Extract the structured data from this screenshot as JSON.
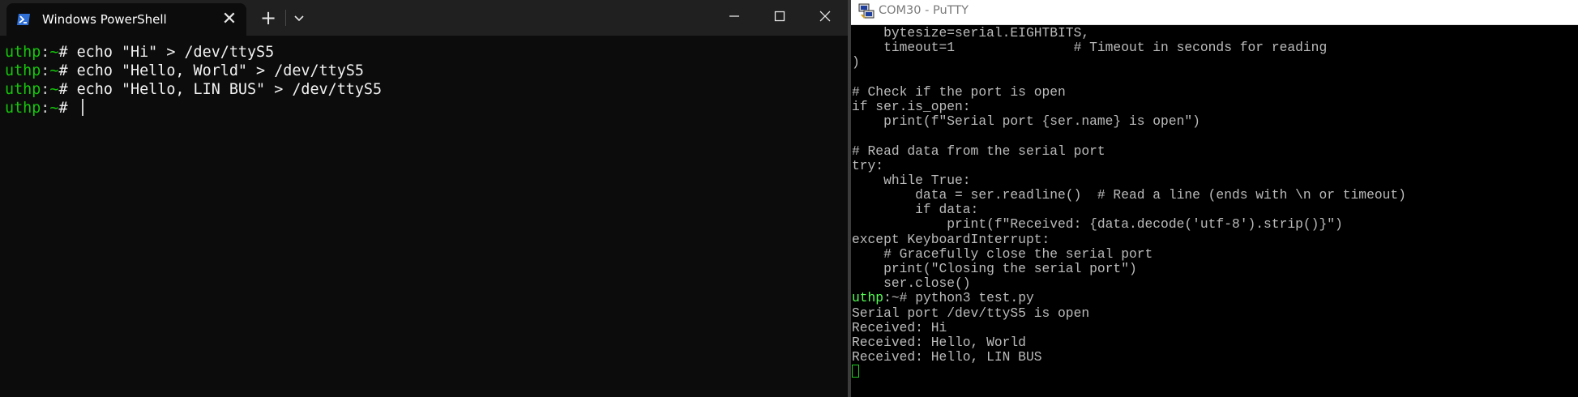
{
  "powershell": {
    "tab_title": "Windows PowerShell",
    "tab_icon": "powershell-icon",
    "new_tab_label": "+",
    "close_tab_label": "✕",
    "prompt": {
      "user": "uthp",
      "sep": ":",
      "path": "~",
      "symbol": "# "
    },
    "lines": [
      {
        "cmd": "echo \"Hi\" > /dev/ttyS5"
      },
      {
        "cmd": "echo \"Hello, World\" > /dev/ttyS5"
      },
      {
        "cmd": "echo \"Hello, LIN BUS\" > /dev/ttyS5"
      }
    ],
    "window_buttons": [
      "minimize-icon",
      "maximize-icon",
      "close-icon"
    ]
  },
  "putty": {
    "title": "COM30 - PuTTY",
    "icon": "putty-icon",
    "lines": [
      "    bytesize=serial.EIGHTBITS,",
      "    timeout=1               # Timeout in seconds for reading",
      ")",
      "",
      "# Check if the port is open",
      "if ser.is_open:",
      "    print(f\"Serial port {ser.name} is open\")",
      "",
      "# Read data from the serial port",
      "try:",
      "    while True:",
      "        data = ser.readline()  # Read a line (ends with \\n or timeout)",
      "        if data:",
      "            print(f\"Received: {data.decode('utf-8').strip()}\")",
      "except KeyboardInterrupt:",
      "    # Gracefully close the serial port",
      "    print(\"Closing the serial port\")",
      "    ser.close()"
    ],
    "prompt": {
      "user": "uthp",
      "rest": ":~# ",
      "cmd": "python3 test.py"
    },
    "output": [
      "Serial port /dev/ttyS5 is open",
      "Received: Hi",
      "Received: Hello, World",
      "Received: Hello, LIN BUS"
    ]
  }
}
